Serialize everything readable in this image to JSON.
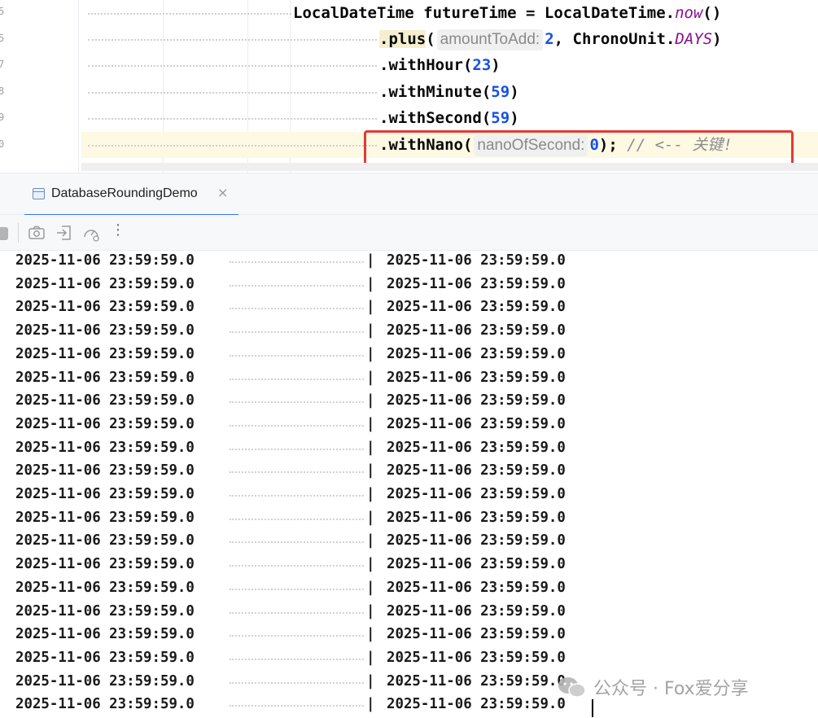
{
  "editor": {
    "line_numbers": [
      "5",
      "5",
      "7",
      "8",
      "9",
      "0"
    ],
    "line1": {
      "type_name": "LocalDateTime",
      "var_name": "futureTime",
      "assign": "=",
      "class_ref": "LocalDateTime",
      "dot": ".",
      "method": "now",
      "parens": "()"
    },
    "line2": {
      "method": ".plus",
      "open": "(",
      "hint": "amountToAdd:",
      "arg1": "2",
      "comma": ",",
      "enum_class": "ChronoUnit",
      "dot": ".",
      "enum_value": "DAYS",
      "close": ")"
    },
    "line3": {
      "method": ".withHour",
      "open": "(",
      "arg": "23",
      "close": ")"
    },
    "line4": {
      "method": ".withMinute",
      "open": "(",
      "arg": "59",
      "close": ")"
    },
    "line5": {
      "method": ".withSecond",
      "open": "(",
      "arg": "59",
      "close": ")"
    },
    "line6": {
      "method": ".withNano",
      "open": "(",
      "hint": "nanoOfSecond:",
      "arg": "0",
      "close": ");",
      "comment": "// <-- 关键!"
    }
  },
  "run_tab": {
    "label": "DatabaseRoundingDemo",
    "close": "×"
  },
  "toolbar": {
    "more": "⋮"
  },
  "console": {
    "separator": "|",
    "rows": [
      [
        "2025-11-06 23:59:59.0",
        "2025-11-06 23:59:59.0"
      ],
      [
        "2025-11-06 23:59:59.0",
        "2025-11-06 23:59:59.0"
      ],
      [
        "2025-11-06 23:59:59.0",
        "2025-11-06 23:59:59.0"
      ],
      [
        "2025-11-06 23:59:59.0",
        "2025-11-06 23:59:59.0"
      ],
      [
        "2025-11-06 23:59:59.0",
        "2025-11-06 23:59:59.0"
      ],
      [
        "2025-11-06 23:59:59.0",
        "2025-11-06 23:59:59.0"
      ],
      [
        "2025-11-06 23:59:59.0",
        "2025-11-06 23:59:59.0"
      ],
      [
        "2025-11-06 23:59:59.0",
        "2025-11-06 23:59:59.0"
      ],
      [
        "2025-11-06 23:59:59.0",
        "2025-11-06 23:59:59.0"
      ],
      [
        "2025-11-06 23:59:59.0",
        "2025-11-06 23:59:59.0"
      ],
      [
        "2025-11-06 23:59:59.0",
        "2025-11-06 23:59:59.0"
      ],
      [
        "2025-11-06 23:59:59.0",
        "2025-11-06 23:59:59.0"
      ],
      [
        "2025-11-06 23:59:59.0",
        "2025-11-06 23:59:59.0"
      ],
      [
        "2025-11-06 23:59:59.0",
        "2025-11-06 23:59:59.0"
      ],
      [
        "2025-11-06 23:59:59.0",
        "2025-11-06 23:59:59.0"
      ],
      [
        "2025-11-06 23:59:59.0",
        "2025-11-06 23:59:59.0"
      ],
      [
        "2025-11-06 23:59:59.0",
        "2025-11-06 23:59:59.0"
      ],
      [
        "2025-11-06 23:59:59.0",
        "2025-11-06 23:59:59.0"
      ],
      [
        "2025-11-06 23:59:59.0",
        "2025-11-06 23:59:59.0"
      ],
      [
        "2025-11-06 23:59:59.0",
        "2025-11-06 23:59:59.0"
      ]
    ]
  },
  "watermark": {
    "text": "公众号 · Fox爱分享"
  },
  "colors": {
    "keyword_number": "#1750eb",
    "static_member": "#871094",
    "comment": "#8c8c8c",
    "highlight_box": "#e53935",
    "tab_accent": "#3574f0"
  }
}
